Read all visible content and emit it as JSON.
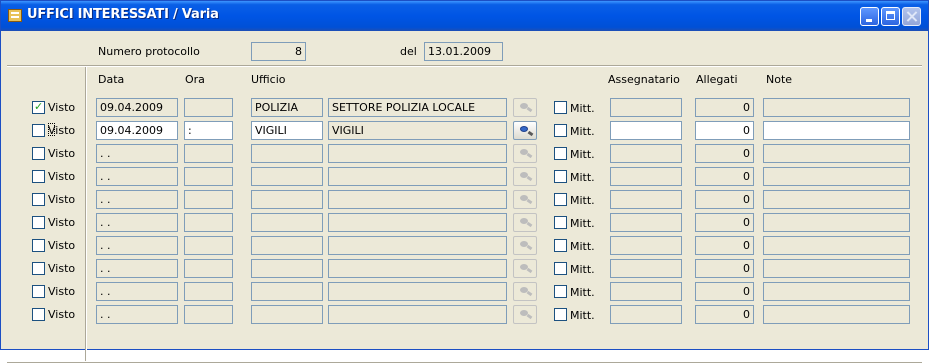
{
  "window": {
    "title": "UFFICI INTERESSATI / Varia"
  },
  "header": {
    "protocol_label": "Numero protocollo",
    "protocol_value": "8",
    "date_label": "del",
    "date_value": "13.01.2009"
  },
  "columns": {
    "data": "Data",
    "ora": "Ora",
    "ufficio": "Ufficio",
    "assegnatario": "Assegnatario",
    "allegati": "Allegati",
    "note": "Note"
  },
  "row_labels": {
    "visto": "Visto",
    "mitt": "Mitt."
  },
  "rows": [
    {
      "visto": true,
      "data": "09.04.2009",
      "ora": "",
      "ufficio_code": "POLIZIA",
      "ufficio_desc": "SETTORE POLIZIA LOCALE",
      "mitt": false,
      "assegnatario": "",
      "allegati": "0",
      "note": ""
    },
    {
      "visto": false,
      "data": "09.04.2009",
      "ora": ":",
      "ufficio_code": "VIGILI",
      "ufficio_desc": "VIGILI",
      "mitt": false,
      "assegnatario": "",
      "allegati": "0",
      "note": ""
    },
    {
      "visto": false,
      "data": ". .",
      "ora": "",
      "ufficio_code": "",
      "ufficio_desc": "",
      "mitt": false,
      "assegnatario": "",
      "allegati": "0",
      "note": ""
    },
    {
      "visto": false,
      "data": ". .",
      "ora": "",
      "ufficio_code": "",
      "ufficio_desc": "",
      "mitt": false,
      "assegnatario": "",
      "allegati": "0",
      "note": ""
    },
    {
      "visto": false,
      "data": ". .",
      "ora": "",
      "ufficio_code": "",
      "ufficio_desc": "",
      "mitt": false,
      "assegnatario": "",
      "allegati": "0",
      "note": ""
    },
    {
      "visto": false,
      "data": ". .",
      "ora": "",
      "ufficio_code": "",
      "ufficio_desc": "",
      "mitt": false,
      "assegnatario": "",
      "allegati": "0",
      "note": ""
    },
    {
      "visto": false,
      "data": ". .",
      "ora": "",
      "ufficio_code": "",
      "ufficio_desc": "",
      "mitt": false,
      "assegnatario": "",
      "allegati": "0",
      "note": ""
    },
    {
      "visto": false,
      "data": ". .",
      "ora": "",
      "ufficio_code": "",
      "ufficio_desc": "",
      "mitt": false,
      "assegnatario": "",
      "allegati": "0",
      "note": ""
    },
    {
      "visto": false,
      "data": ". .",
      "ora": "",
      "ufficio_code": "",
      "ufficio_desc": "",
      "mitt": false,
      "assegnatario": "",
      "allegati": "0",
      "note": ""
    },
    {
      "visto": false,
      "data": ". .",
      "ora": "",
      "ufficio_code": "",
      "ufficio_desc": "",
      "mitt": false,
      "assegnatario": "",
      "allegati": "0",
      "note": ""
    }
  ],
  "active_row_index": 1,
  "icons": {
    "window": "app-window-icon",
    "lookup": "search-binoculars-icon",
    "check": "checkmark-icon"
  },
  "colors": {
    "titlebar": "#0055e5",
    "face": "#ece9d8",
    "field_border": "#7f9db9",
    "check_mark": "#21a121"
  }
}
